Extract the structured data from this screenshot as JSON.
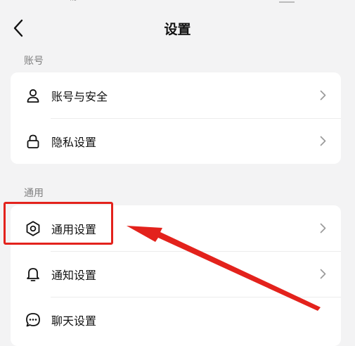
{
  "header": {
    "title": "设置",
    "back_icon": "chevron-left-icon"
  },
  "sections": [
    {
      "label": "账号",
      "items": [
        {
          "label": "账号与安全",
          "icon": "user-icon"
        },
        {
          "label": "隐私设置",
          "icon": "lock-icon"
        }
      ]
    },
    {
      "label": "通用",
      "items": [
        {
          "label": "通用设置",
          "icon": "gear-icon"
        },
        {
          "label": "通知设置",
          "icon": "bell-icon"
        },
        {
          "label": "聊天设置",
          "icon": "chat-bubble-icon"
        }
      ]
    }
  ],
  "annotation": {
    "highlight_color": "#e3221c",
    "highlighted_item": "通用设置"
  },
  "colors": {
    "background": "#f3f3f4",
    "card": "#ffffff",
    "section_label": "#7f7f7f"
  }
}
